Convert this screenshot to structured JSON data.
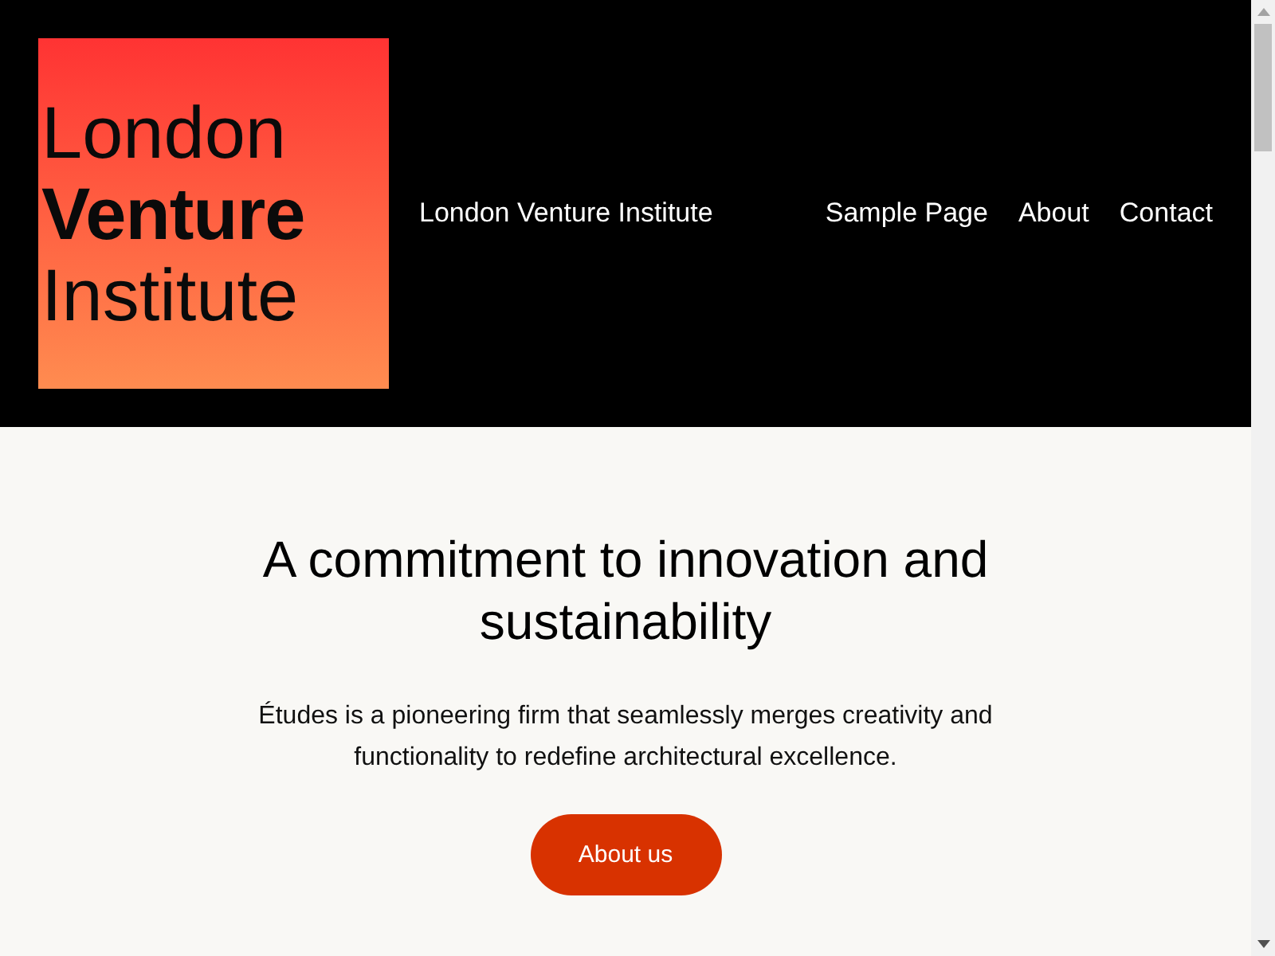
{
  "header": {
    "logo": {
      "lines": [
        {
          "text": "London",
          "bold": false
        },
        {
          "text": "Venture",
          "bold": true
        },
        {
          "text": "Institute",
          "bold": false
        }
      ]
    },
    "site_title": "London Venture Institute",
    "nav": [
      {
        "label": "Sample Page"
      },
      {
        "label": "About"
      },
      {
        "label": "Contact"
      }
    ]
  },
  "hero": {
    "heading": "A commitment to innovation and sustainability",
    "text": "Études is a pioneering firm that seamlessly merges creativity and functionality to redefine architectural excellence.",
    "button": "About us"
  }
}
